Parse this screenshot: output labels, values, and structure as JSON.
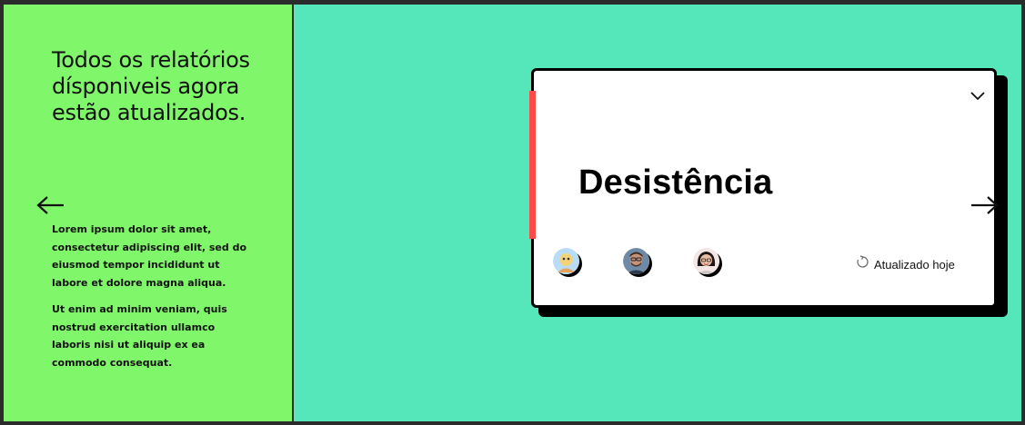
{
  "left": {
    "title": "Todos os relatórios dísponiveis agora estão atualizados.",
    "back_icon": "arrow-left-icon",
    "paragraphs": [
      "Lorem ipsum dolor sit amet, consectetur adipiscing elit, sed do eiusmod tempor incididunt ut labore et dolore magna aliqua.",
      "Ut enim ad minim veniam, quis nostrud exercitation ullamco laboris nisi ut aliquip ex ea commodo consequat."
    ]
  },
  "card": {
    "title": "Desistência",
    "expand_icon": "chevron-down-icon",
    "next_icon": "arrow-right-icon",
    "accent_color": "#ff4a4a",
    "avatars": [
      "avatar-cartoon",
      "avatar-man-glasses",
      "avatar-woman-glasses"
    ],
    "status_icon": "refresh-icon",
    "status": "Atualizado hoje"
  },
  "colors": {
    "left_panel": "#80f76a",
    "background": "#55e6b9"
  }
}
